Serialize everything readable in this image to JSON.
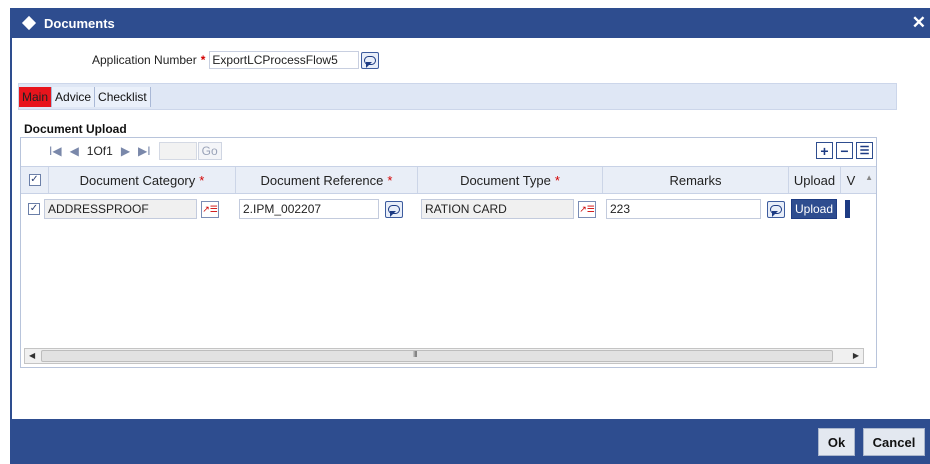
{
  "window": {
    "title": "Documents",
    "close_symbol": "✕"
  },
  "header": {
    "app_number_label": "Application Number",
    "required_marker": "*",
    "app_number_value": "ExportLCProcessFlow5"
  },
  "tabs": [
    {
      "label": "Main",
      "active": true
    },
    {
      "label": "Advice",
      "active": false
    },
    {
      "label": "Checklist",
      "active": false
    }
  ],
  "section": {
    "title": "Document Upload"
  },
  "pager": {
    "first": "I◀",
    "prev": "◀",
    "page_info": "1Of1",
    "next": "▶",
    "last": "▶I",
    "go_label": "Go"
  },
  "grid_tools": {
    "add": "+",
    "remove": "−",
    "single_view": "☰"
  },
  "columns": {
    "document_category": "Document Category",
    "document_reference": "Document Reference",
    "document_type": "Document Type",
    "remarks": "Remarks",
    "upload": "Upload",
    "extra": "V"
  },
  "rows": [
    {
      "checked": true,
      "document_category": "ADDRESSPROOF",
      "document_reference": "2.IPM_002207",
      "document_type": "RATION CARD",
      "remarks": "223",
      "upload_label": "Upload"
    }
  ],
  "scroll": {
    "grip": "III"
  },
  "footer": {
    "ok_label": "Ok",
    "cancel_label": "Cancel"
  },
  "colors": {
    "brand": "#2e4d8f",
    "active_tab": "#e8141c",
    "required": "#d40000"
  }
}
